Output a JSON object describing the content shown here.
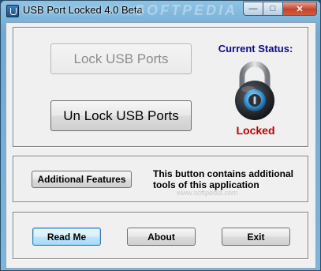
{
  "window": {
    "title": "USB Port Locked 4.0 Beta",
    "watermark": "SOFTPEDIA",
    "icon": "usb-app-icon"
  },
  "caption_buttons": {
    "minimize": "—",
    "maximize": "□",
    "close": "✕"
  },
  "main": {
    "lock_button": "Lock USB Ports",
    "unlock_button": "Un Lock USB Ports",
    "lock_button_enabled": false,
    "status_label": "Current Status:",
    "status_value": "Locked",
    "status_icon": "padlock-icon",
    "colors": {
      "status_label": "#0a0a8c",
      "status_value": "#c00000"
    }
  },
  "features": {
    "button": "Additional Features",
    "description": "This button contains additional tools of this application",
    "site_watermark": "www.softpedia.com"
  },
  "footer": {
    "readme_button": "Read Me",
    "about_button": "About",
    "exit_button": "Exit"
  }
}
